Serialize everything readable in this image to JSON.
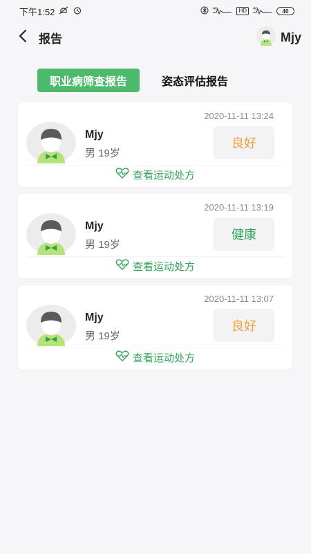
{
  "status_bar": {
    "time": "下午1:52",
    "signal_labels": [
      "4G",
      "HD",
      "4G"
    ],
    "battery": "40"
  },
  "header": {
    "back_icon": "chevron-left-icon",
    "title": "报告",
    "user_name": "Mjy"
  },
  "tabs": [
    {
      "label": "职业病筛查报告",
      "active": true
    },
    {
      "label": "姿态评估报告",
      "active": false
    }
  ],
  "reports": [
    {
      "date": "2020-11-11 13:24",
      "name": "Mjy",
      "meta": "男 19岁",
      "status": "良好",
      "status_color": "#f0a23a",
      "link": "查看运动处方"
    },
    {
      "date": "2020-11-11 13:19",
      "name": "Mjy",
      "meta": "男 19岁",
      "status": "健康",
      "status_color": "#33a55a",
      "link": "查看运动处方"
    },
    {
      "date": "2020-11-11 13:07",
      "name": "Mjy",
      "meta": "男 19岁",
      "status": "良好",
      "status_color": "#f0a23a",
      "link": "查看运动处方"
    }
  ],
  "colors": {
    "accent": "#4cb96b",
    "link_green": "#33a55a",
    "status_good": "#f0a23a",
    "background": "#f6f6f8"
  }
}
